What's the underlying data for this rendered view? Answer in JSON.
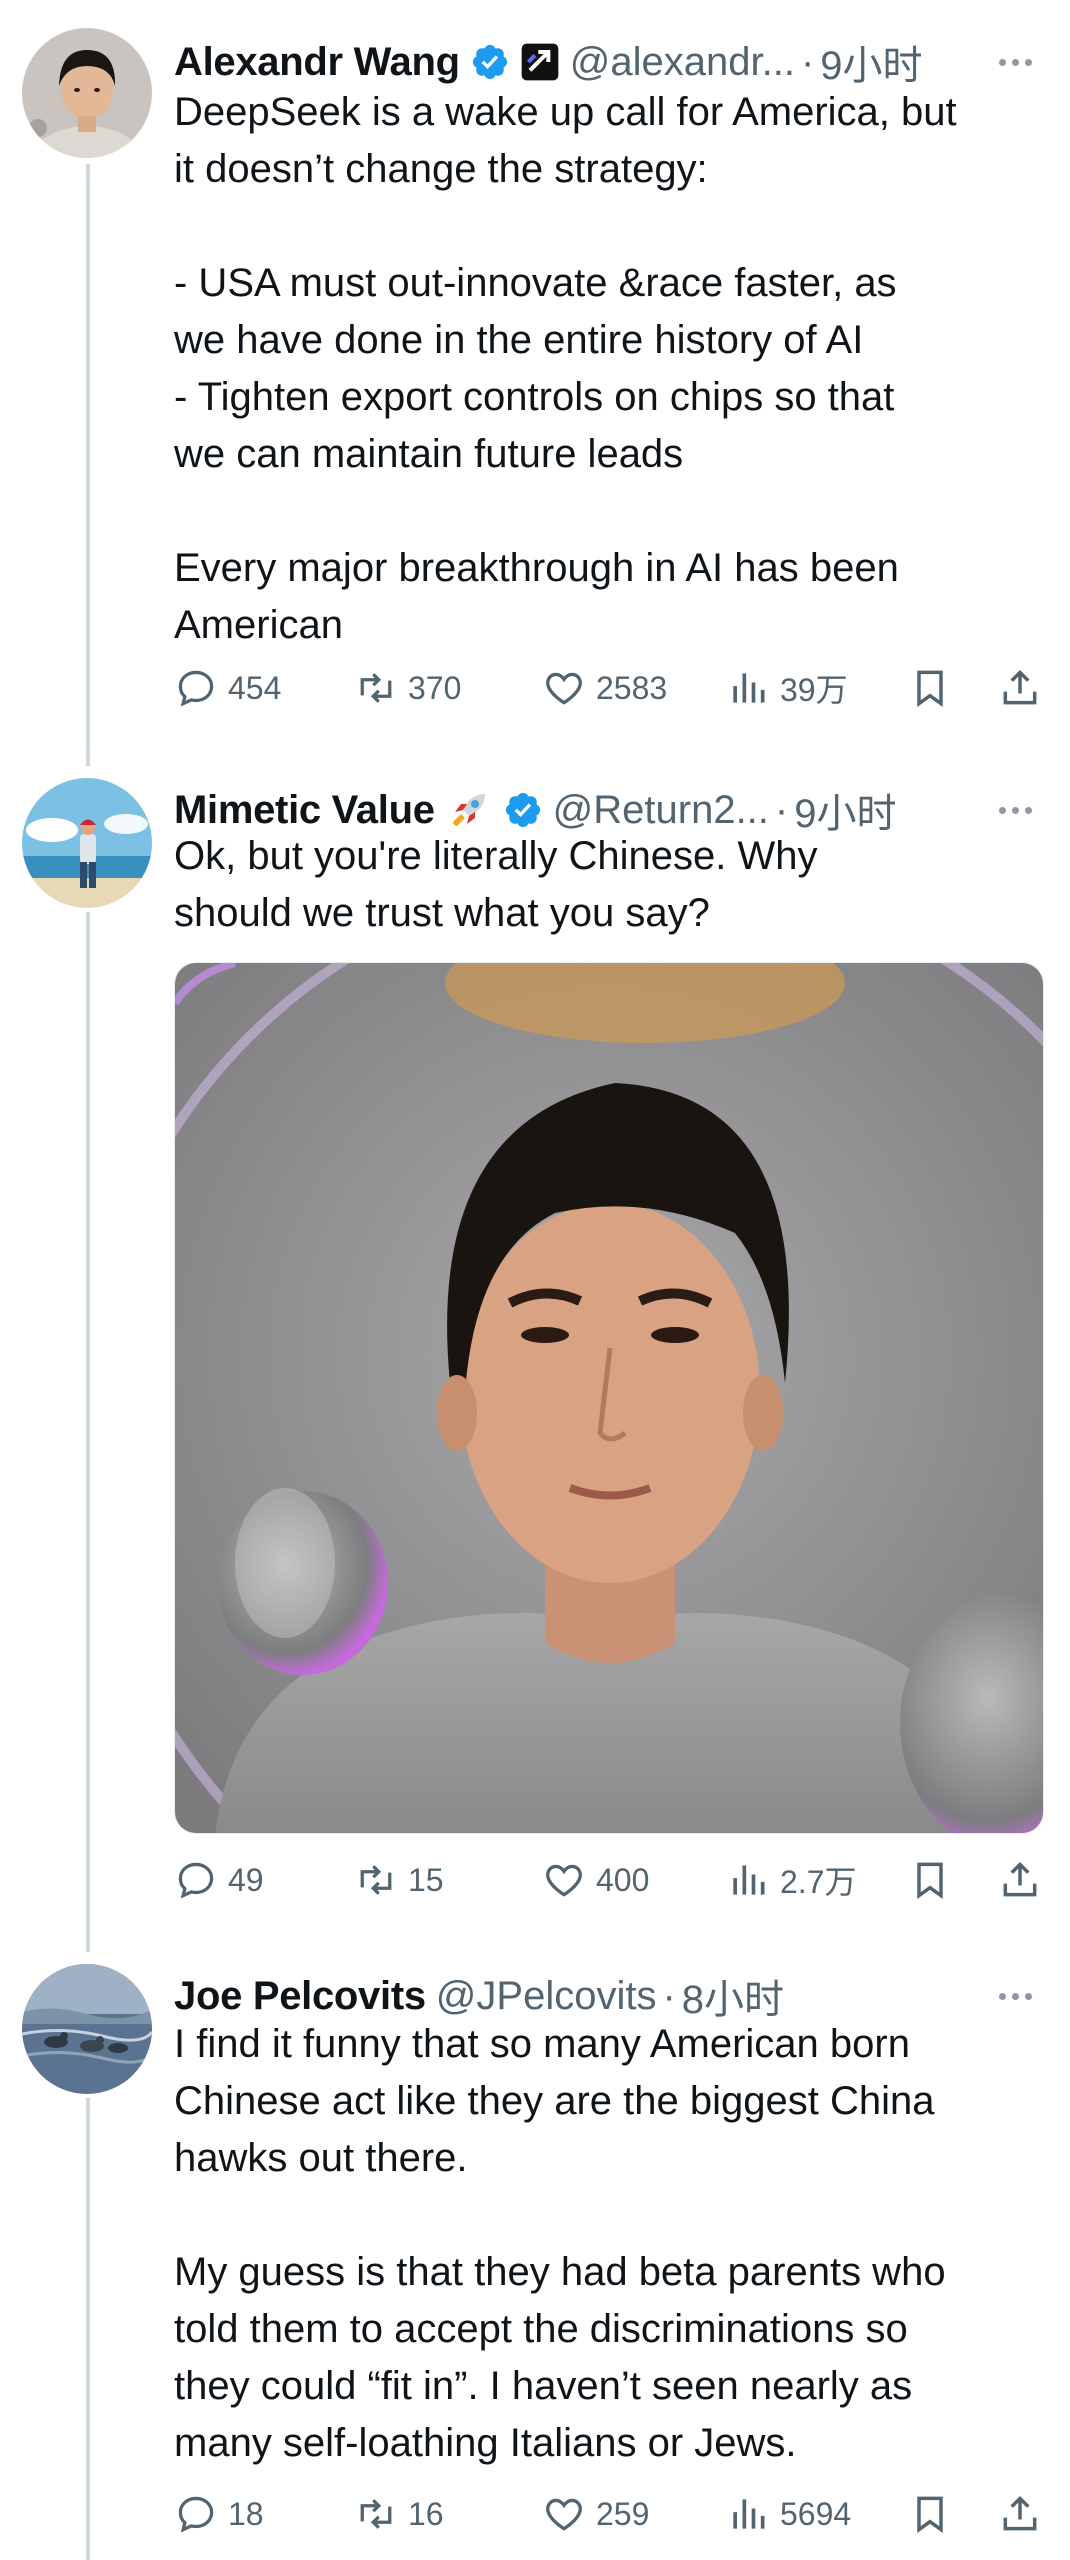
{
  "tweets": [
    {
      "author": "Alexandr Wang",
      "handle": "@alexandr...",
      "separator": "·",
      "time": "9小时",
      "text": "DeepSeek is a wake up call for America, but\nit doesn’t change the strategy:\n\n- USA must out-innovate &race faster, as\nwe have done in the entire history of AI\n- Tighten export controls on chips so that\nwe can maintain future leads\n\nEvery major breakthrough in AI has been\nAmerican",
      "replies": "454",
      "retweets": "370",
      "likes": "2583",
      "views": "39万"
    },
    {
      "author": "Mimetic Value",
      "author_emoji": "rocket-icon",
      "handle": "@Return2...",
      "separator": "·",
      "time": "9小时",
      "text": "Ok,  but you're literally Chinese. Why\nshould we trust what you say?",
      "media": "portrait-photo",
      "replies": "49",
      "retweets": "15",
      "likes": "400",
      "views": "2.7万"
    },
    {
      "author": "Joe Pelcovits",
      "handle": "@JPelcovits",
      "separator": "·",
      "time": "8小时",
      "text": "I find it funny that so many American born\nChinese act like they are the biggest China\nhawks out there.\n\nMy guess is that they had beta parents who\ntold them to accept the discriminations so\nthey could “fit in”. I haven’t seen nearly as\nmany self-loathing Italians or Jews.",
      "replies": "18",
      "retweets": "16",
      "likes": "259",
      "views": "5694"
    }
  ],
  "colors": {
    "text": "#0f1419",
    "secondary": "#536471",
    "verified": "#1d9bf0",
    "thread_line": "#cfd9de"
  }
}
